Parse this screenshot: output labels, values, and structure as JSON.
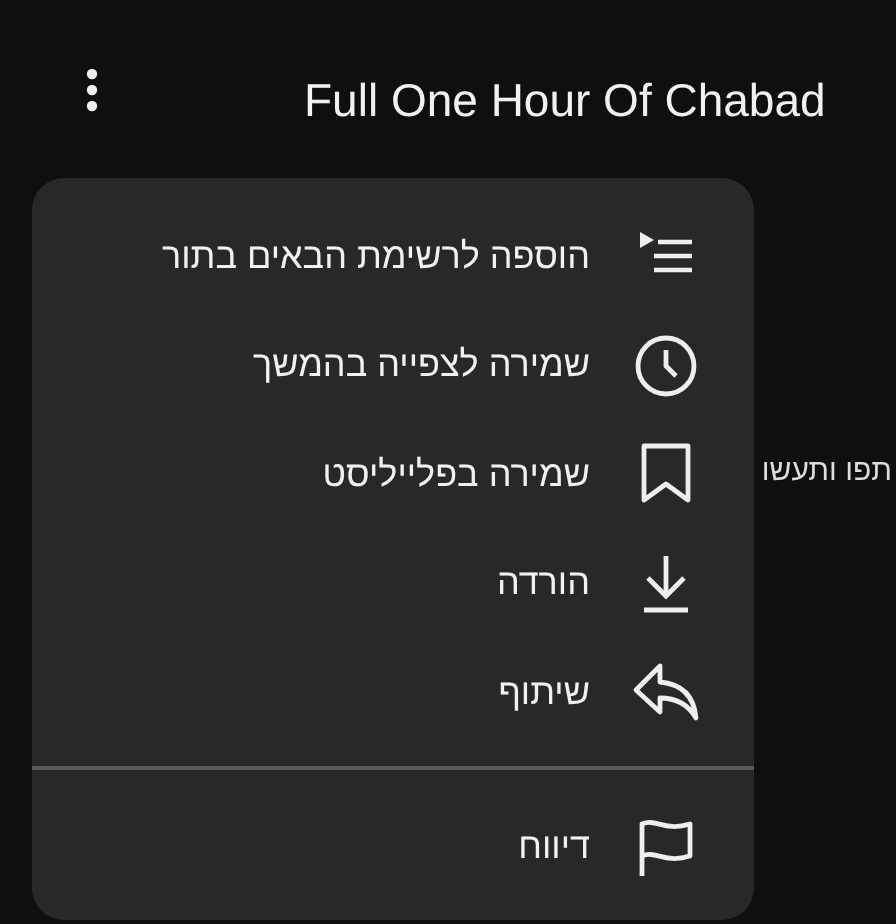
{
  "header": {
    "title": "Full One Hour Of Chabad"
  },
  "background_text": "תפו ותעשו",
  "menu": {
    "groups": [
      [
        {
          "kind": "queue",
          "label": "הוספה לרשימת הבאים בתור"
        },
        {
          "kind": "clock",
          "label": "שמירה לצפייה בהמשך"
        },
        {
          "kind": "bookmark",
          "label": "שמירה בפלייליסט"
        },
        {
          "kind": "download",
          "label": "הורדה"
        },
        {
          "kind": "share",
          "label": "שיתוף"
        }
      ],
      [
        {
          "kind": "flag",
          "label": "דיווח"
        }
      ]
    ]
  }
}
